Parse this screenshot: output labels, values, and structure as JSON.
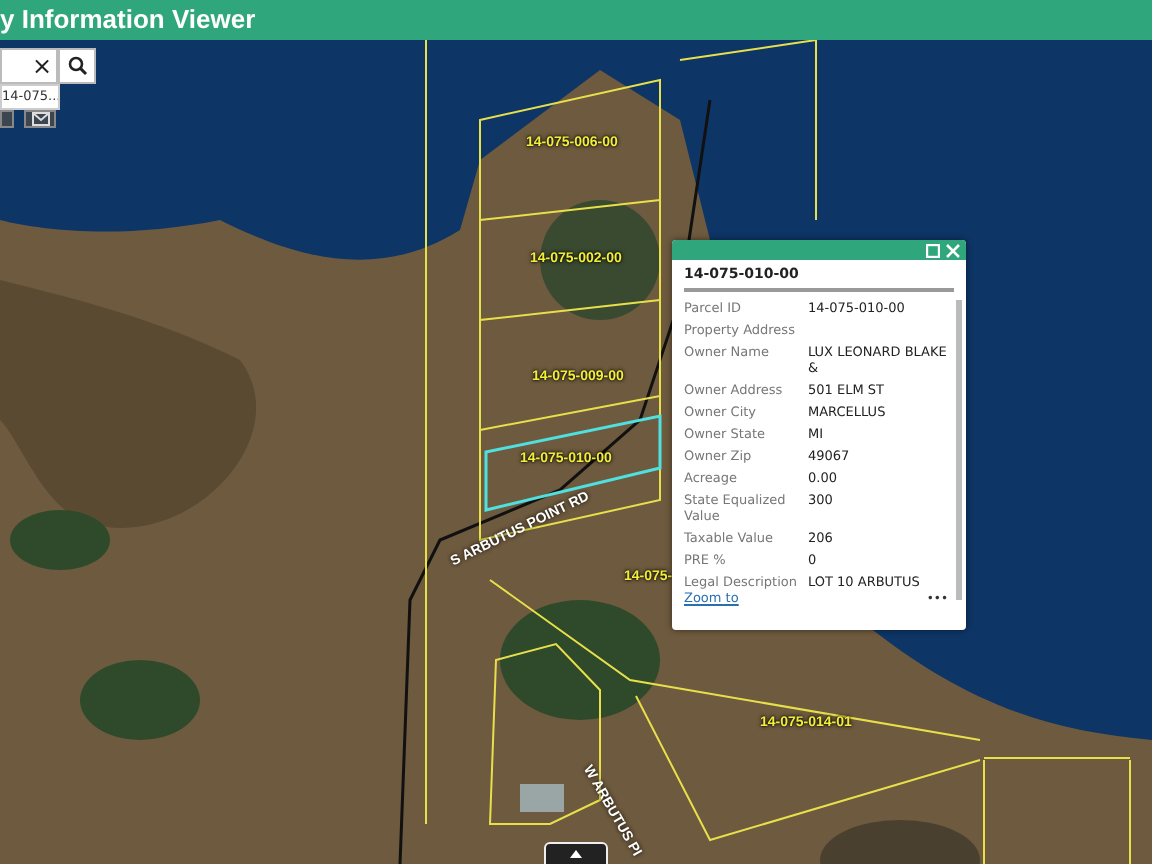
{
  "header": {
    "title": "y Information Viewer"
  },
  "search": {
    "clear": "×",
    "suggestion": "14-075..."
  },
  "map": {
    "parcel_labels": [
      "14-075-006-00",
      "14-075-002-00",
      "14-075-009-00",
      "14-075-010-00",
      "14-075-",
      "14-075-014-01"
    ],
    "road_labels": [
      "S ARBUTUS POINT RD",
      "W ARBUTUS PI"
    ]
  },
  "popup": {
    "title": "14-075-010-00",
    "fields": [
      {
        "label": "Parcel ID",
        "value": "14-075-010-00"
      },
      {
        "label": "Property Address"
      },
      {
        "label": "Owner Name",
        "value": "LUX LEONARD BLAKE &"
      },
      {
        "label": "Owner Address",
        "value": "501 ELM ST"
      },
      {
        "label": "Owner City",
        "value": "MARCELLUS"
      },
      {
        "label": "Owner State",
        "value": "MI"
      },
      {
        "label": "Owner Zip",
        "value": "49067"
      },
      {
        "label": "Acreage",
        "value": "0.00"
      },
      {
        "label": "State Equalized Value",
        "value": "300"
      },
      {
        "label": "Taxable Value",
        "value": "206"
      },
      {
        "label": "PRE %",
        "value": "0"
      },
      {
        "label": "Legal Description",
        "value": "LOT 10 ARBUTUS"
      }
    ],
    "link": "Zoom to",
    "more": "•••"
  }
}
